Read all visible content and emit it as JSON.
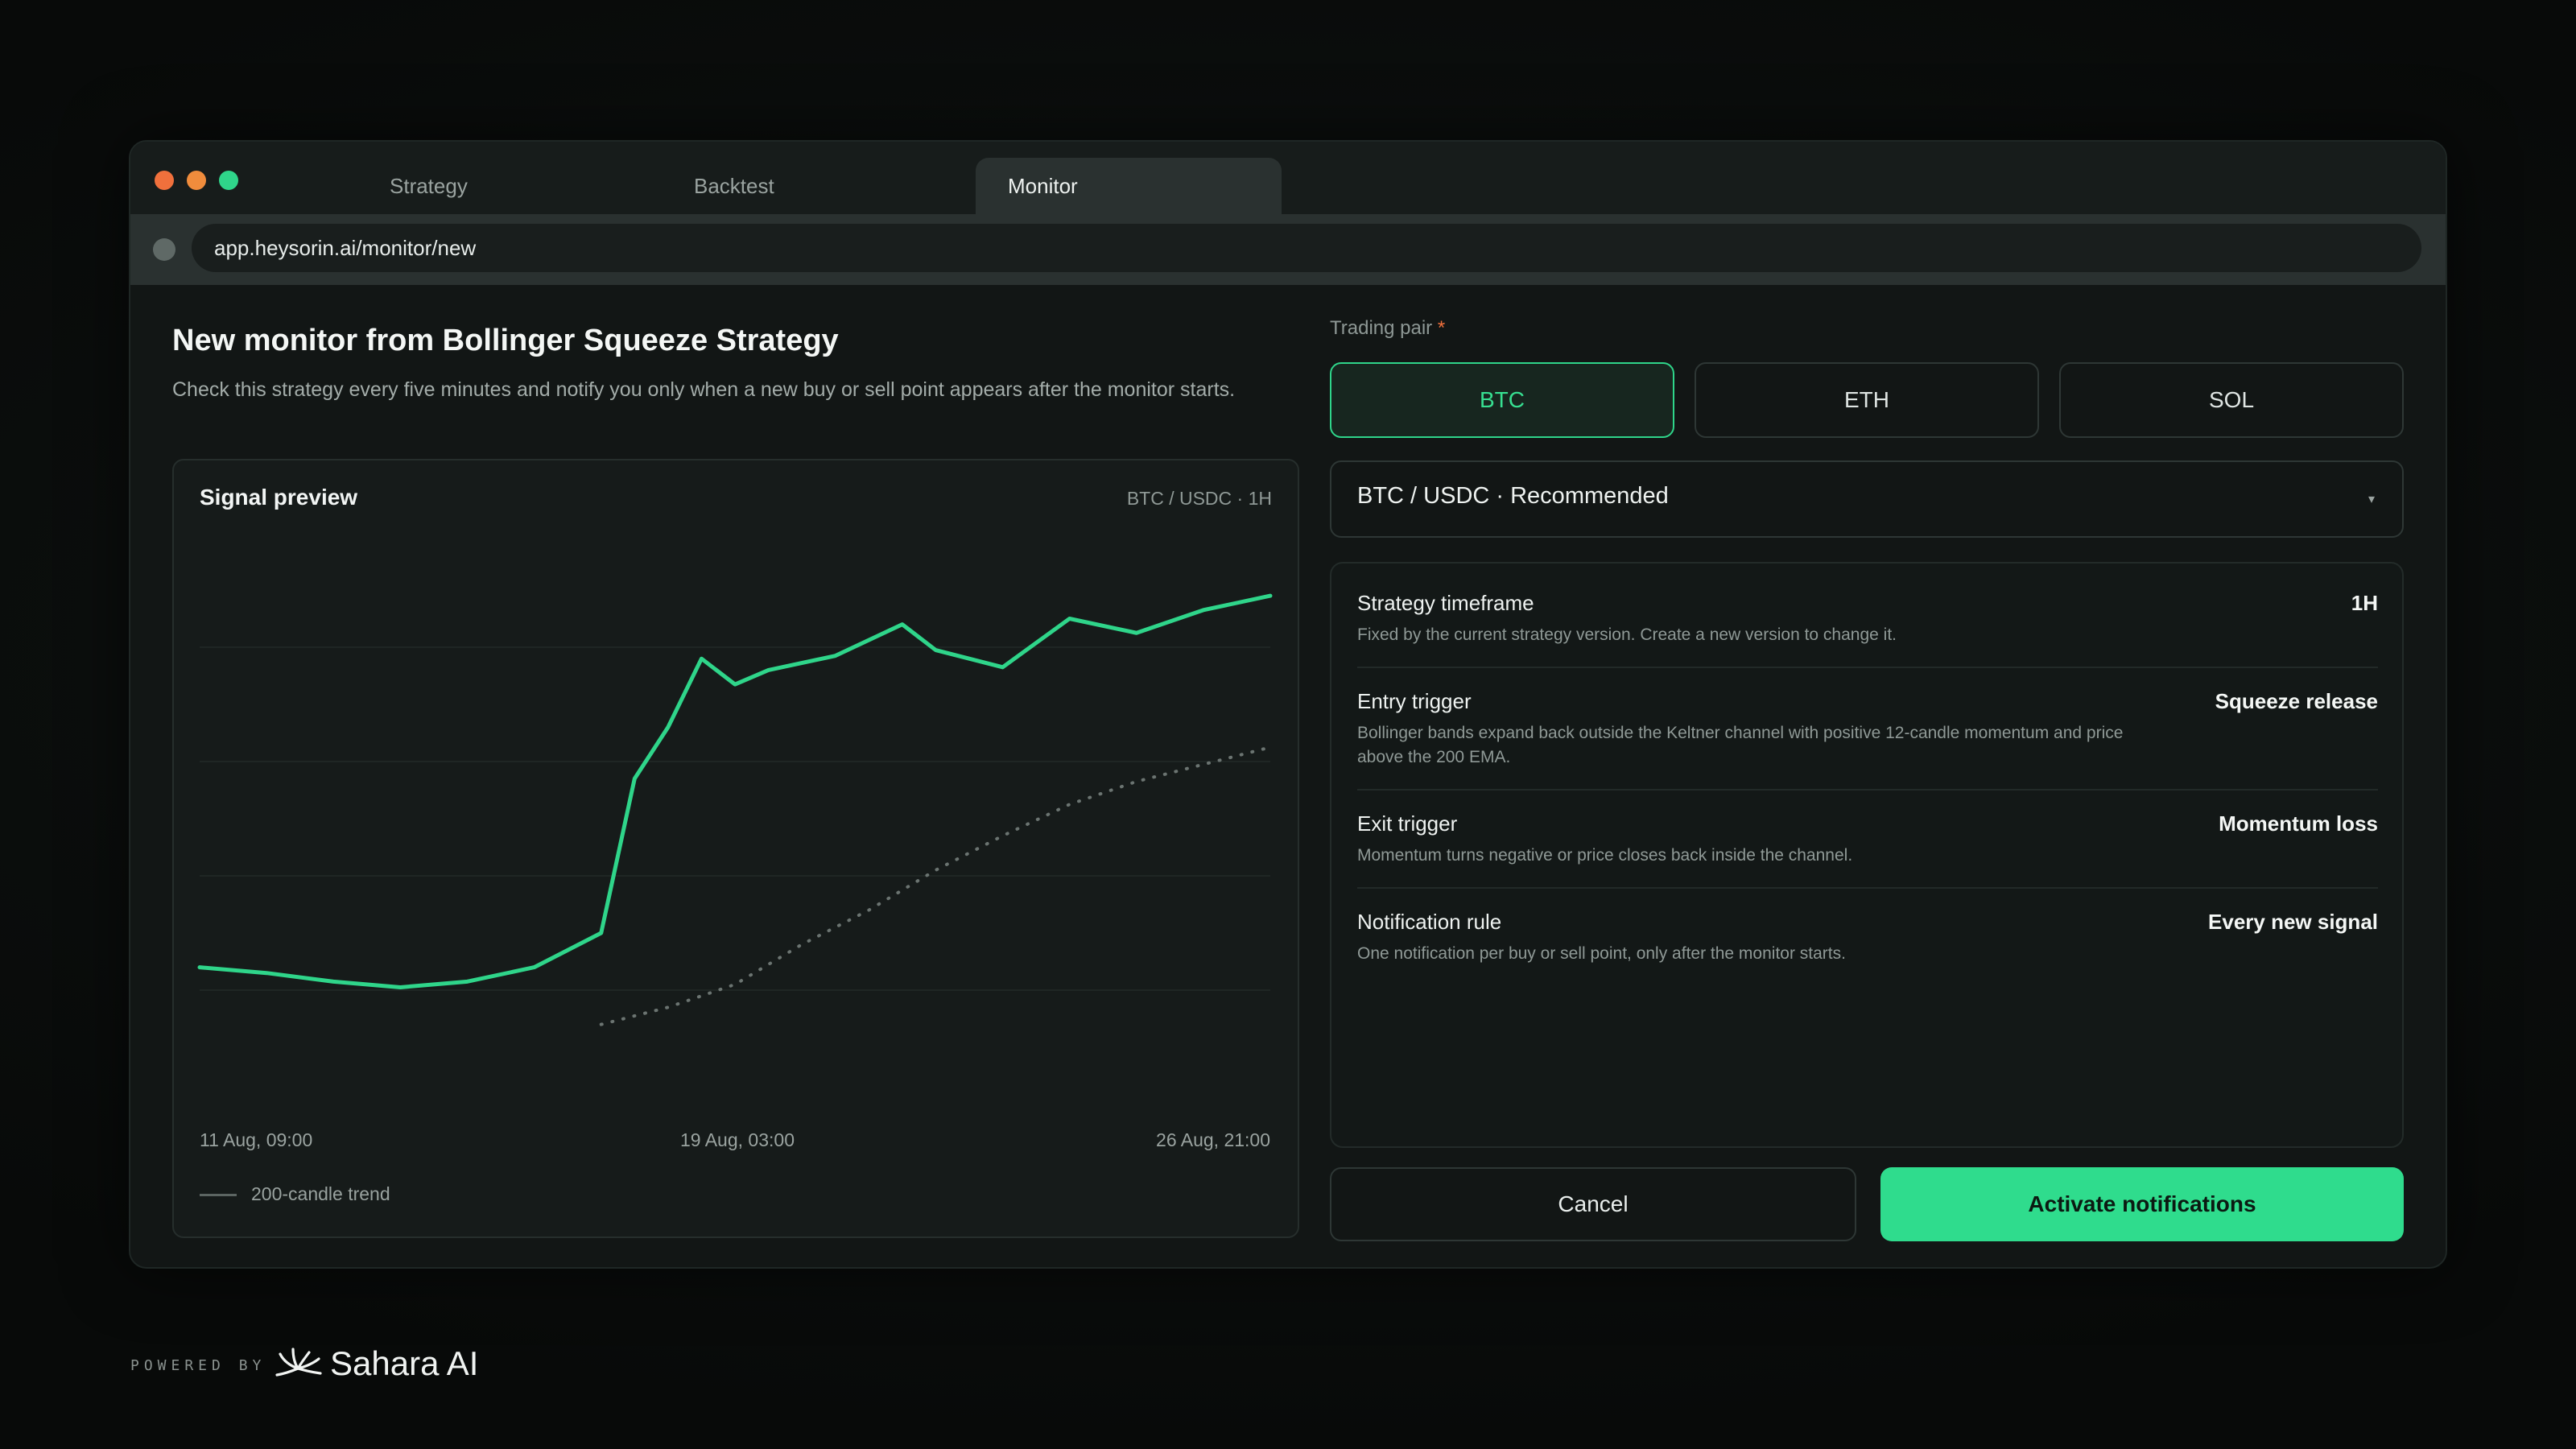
{
  "browser": {
    "tabs": [
      {
        "label": "Strategy",
        "active": false
      },
      {
        "label": "Backtest",
        "active": false
      },
      {
        "label": "Monitor",
        "active": true
      }
    ],
    "url": "app.heysorin.ai/monitor/new"
  },
  "page": {
    "title": "New monitor from Bollinger Squeeze Strategy",
    "description": "Check this strategy every five minutes and notify you only when a new buy or sell point appears after the monitor starts."
  },
  "chart_card": {
    "title": "Signal preview",
    "meta": "BTC / USDC · 1H",
    "legend_label": "200-candle trend"
  },
  "chart_data": {
    "type": "line",
    "title": "Signal preview",
    "subtitle": "BTC / USDC · 1H",
    "x_tick_labels": [
      "11 Aug, 09:00",
      "19 Aug, 03:00",
      "26 Aug, 21:00"
    ],
    "ylim": [
      0,
      100
    ],
    "grid": true,
    "series": [
      {
        "style": "solid",
        "color": "#2fd58a",
        "x": [
          0,
          2,
          4,
          6,
          8,
          10,
          12,
          13,
          14,
          15,
          16,
          17,
          19,
          21,
          22,
          24,
          26,
          28,
          30,
          32
        ],
        "y": [
          24,
          23,
          21.5,
          20.5,
          21.5,
          24,
          30,
          57,
          66,
          78,
          73.5,
          76,
          78.5,
          84,
          79.5,
          76.5,
          85,
          82.5,
          86.5,
          89
        ]
      },
      {
        "name": "200-candle trend",
        "style": "dotted",
        "color": "#6b7471",
        "x": [
          12,
          14,
          16,
          18,
          20,
          22,
          24,
          26,
          28,
          30,
          32
        ],
        "y": [
          14,
          17,
          21,
          28,
          34,
          41,
          47,
          52.5,
          56.5,
          59.5,
          62.5
        ]
      }
    ]
  },
  "form": {
    "trading_pair_label": "Trading pair",
    "required_mark": "*",
    "pairs": [
      {
        "label": "BTC",
        "selected": true
      },
      {
        "label": "ETH",
        "selected": false
      },
      {
        "label": "SOL",
        "selected": false
      }
    ],
    "market_select_value": "BTC / USDC · Recommended",
    "caret": "▾",
    "rules": [
      {
        "title": "Strategy timeframe",
        "value": "1H",
        "description": "Fixed by the current strategy version. Create a new version to change it."
      },
      {
        "title": "Entry trigger",
        "value": "Squeeze release",
        "description": "Bollinger bands expand back outside the Keltner channel with positive 12-candle momentum and price above the 200 EMA."
      },
      {
        "title": "Exit trigger",
        "value": "Momentum loss",
        "description": "Momentum turns negative or price closes back inside the channel."
      },
      {
        "title": "Notification rule",
        "value": "Every new signal",
        "description": "One notification per buy or sell point, only after the monitor starts."
      }
    ],
    "cancel_label": "Cancel",
    "activate_label": "Activate notifications"
  },
  "footer": {
    "powered_by": "POWERED BY",
    "brand": "Sahara AI"
  },
  "colors": {
    "accent": "#2fd58a",
    "background": "#0b0e0d",
    "panel": "#121615"
  }
}
